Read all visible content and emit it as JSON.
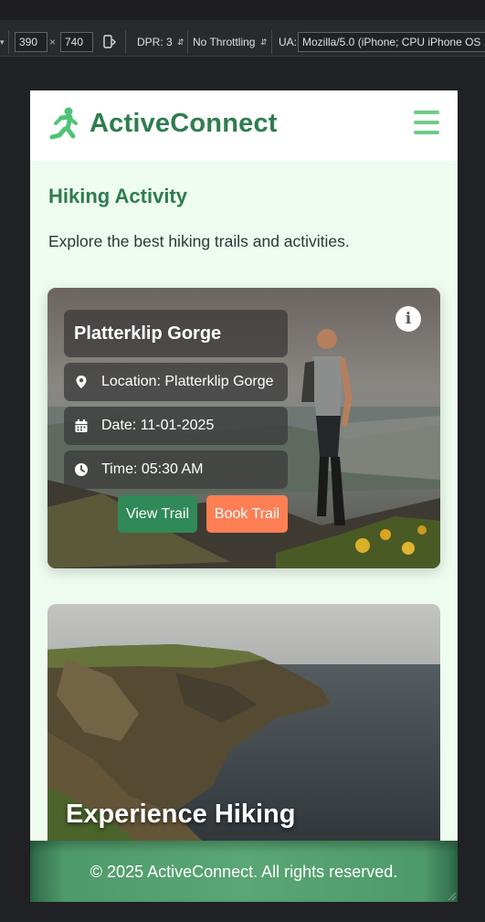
{
  "devtools": {
    "width_value": "390",
    "times_sign": "×",
    "height_value": "740",
    "dpr_label": "DPR: 3",
    "throttling_label": "No Throttling",
    "ua_label": "UA:",
    "ua_value": "Mozilla/5.0 (iPhone; CPU iPhone OS 14"
  },
  "header": {
    "brand": "ActiveConnect",
    "brand_color": "#2e7d4f",
    "logo_icon": "running-person-icon",
    "menu_icon": "hamburger-icon"
  },
  "page": {
    "title": "Hiking Activity",
    "intro": "Explore the best hiking trails and activities."
  },
  "trail_card": {
    "name": "Platterklip Gorge",
    "location": "Location: Platterklip Gorge",
    "date": "Date: 11-01-2025",
    "time": "Time: 05:30 AM",
    "view_button": "View Trail",
    "book_button": "Book Trail",
    "info_icon": "info-icon",
    "view_color": "#2f8a57",
    "book_color": "#ff7f54"
  },
  "feature_card": {
    "title": "Experience Hiking"
  },
  "footer": {
    "text": "© 2025 ActiveConnect. All rights reserved."
  }
}
